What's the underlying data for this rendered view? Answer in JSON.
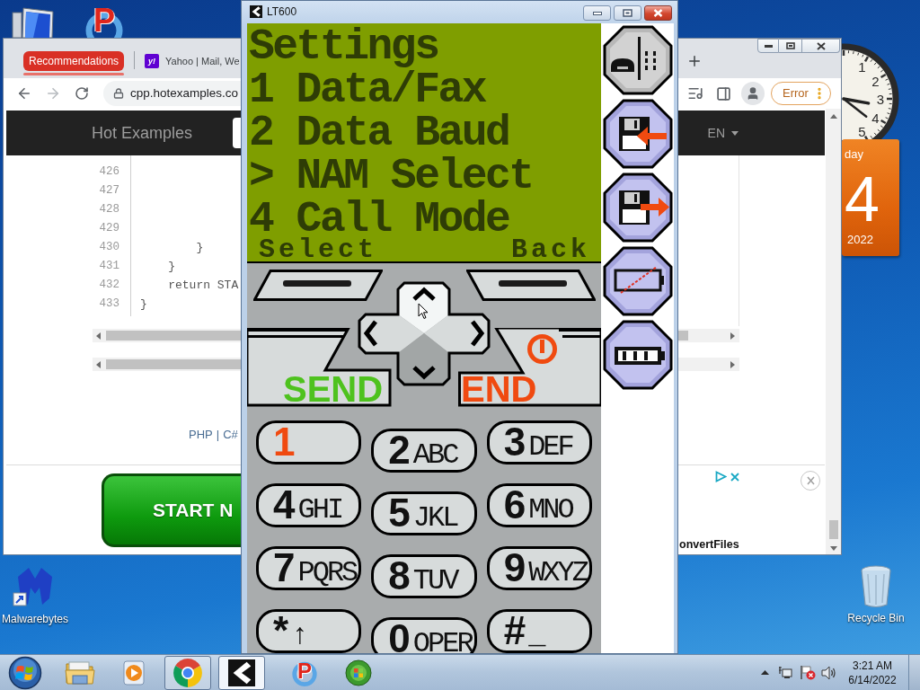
{
  "desktop_icons": [
    {
      "kind": "computer"
    },
    {
      "kind": "letter-app",
      "letter": "P"
    },
    {
      "kind": "m-logo",
      "label": "Malwarebytes"
    },
    {
      "kind": "recycle-bin",
      "label": "Recycle Bin"
    }
  ],
  "clock_gadget": {
    "numerals": [
      "1",
      "2",
      "3",
      "4",
      "5"
    ]
  },
  "calendar_gadget": {
    "weekday": "day",
    "day": "4",
    "year": "2022"
  },
  "browser": {
    "tabs": [
      {
        "kind": "group",
        "label": "Recommendations"
      },
      {
        "kind": "page",
        "favicon": "y!",
        "label": "Yahoo | Mail, We"
      }
    ],
    "forward_disabled": true,
    "address": "cpp.hotexamples.co",
    "profile_status": "Error",
    "site": {
      "brand": "Hot Examples",
      "language": "EN",
      "code_lines": [
        {
          "number": "426"
        },
        {
          "number": "427"
        },
        {
          "number": "428"
        },
        {
          "number": "429"
        },
        {
          "number": "430",
          "code": "        }"
        },
        {
          "number": "431",
          "code": "    }"
        },
        {
          "number": "432",
          "code": "    return STA"
        },
        {
          "number": "433",
          "code": "}"
        }
      ],
      "language_links": [
        "PHP",
        "C#"
      ],
      "link_separator": "|",
      "ad": {
        "button": "START N",
        "brand": "onvertFiles"
      }
    }
  },
  "emulator": {
    "title": "LT600",
    "screen": {
      "lines": [
        "Settings",
        "1 Data/Fax",
        "2 Data Baud",
        "> NAM Select",
        "4 Call Mode"
      ],
      "soft_left": "Select",
      "soft_right": "Back"
    },
    "side_buttons": [
      {
        "kind": "handset"
      },
      {
        "kind": "floppy-in"
      },
      {
        "kind": "floppy-out"
      },
      {
        "kind": "battery-off"
      },
      {
        "kind": "battery-full"
      }
    ],
    "send": "SEND",
    "end": "END",
    "keys": [
      {
        "symbol": "1",
        "color": "#f04a10"
      },
      {
        "symbol": "2",
        "letters": "ABC",
        "color": "#111111"
      },
      {
        "symbol": "3",
        "letters": "DEF",
        "color": "#111111"
      },
      {
        "symbol": "4",
        "letters": "GHI",
        "color": "#111111"
      },
      {
        "symbol": "5",
        "letters": "JKL",
        "color": "#111111"
      },
      {
        "symbol": "6",
        "letters": "MNO",
        "color": "#111111"
      },
      {
        "symbol": "7",
        "letters": "PQRS",
        "color": "#111111"
      },
      {
        "symbol": "8",
        "letters": "TUV",
        "color": "#111111"
      },
      {
        "symbol": "9",
        "letters": "WXYZ",
        "color": "#111111"
      },
      {
        "symbol": "*",
        "letters": "↑",
        "color": "#111111"
      },
      {
        "symbol": "0",
        "letters": "OPER",
        "color": "#111111"
      },
      {
        "symbol": "#",
        "letters": "_",
        "color": "#111111"
      }
    ]
  },
  "taskbar": {
    "items": [
      {
        "kind": "explorer",
        "running": false,
        "selected": false
      },
      {
        "kind": "media",
        "running": false,
        "selected": false
      },
      {
        "kind": "browser",
        "running": true,
        "selected": false
      },
      {
        "kind": "lt600",
        "running": true,
        "selected": true
      },
      {
        "kind": "letter-app",
        "letter": "P",
        "running": false,
        "selected": false
      },
      {
        "kind": "orb",
        "running": false,
        "selected": false
      }
    ],
    "clock": {
      "time": "3:21 AM",
      "date": "6/14/2022"
    }
  }
}
